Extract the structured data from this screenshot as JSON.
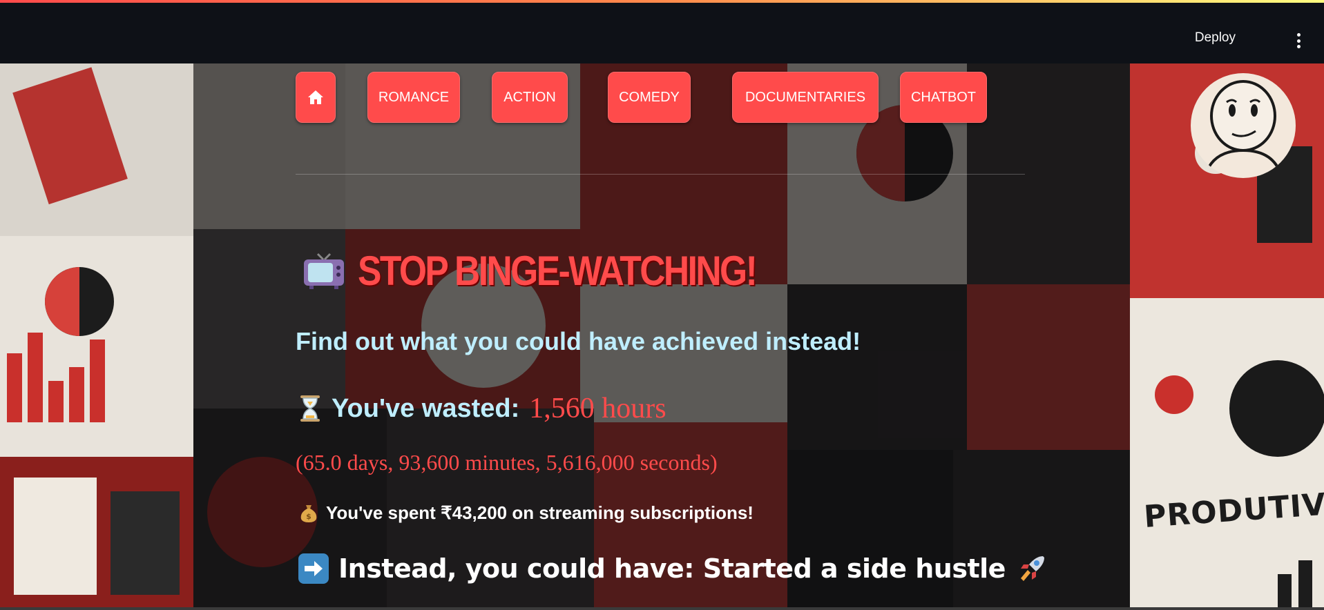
{
  "header": {
    "deploy_label": "Deploy",
    "menu_icon": "more-vertical-icon"
  },
  "nav": {
    "home_icon": "home-icon",
    "items": [
      {
        "label": "ROMANCE"
      },
      {
        "label": "ACTION"
      },
      {
        "label": "COMEDY"
      },
      {
        "label": "DOCUMENTARIES"
      },
      {
        "label": "CHATBOT"
      }
    ]
  },
  "main": {
    "title": "STOP BINGE-WATCHING!",
    "title_icon": "television-icon",
    "subtitle": "Find out what you could have achieved instead!",
    "wasted": {
      "icon": "hourglass-icon",
      "label": "You've wasted:",
      "value": "1,560 hours"
    },
    "breakdown": "(65.0 days, 93,600 minutes, 5,616,000 seconds)",
    "spent": {
      "icon": "money-bag-icon",
      "text": "You've spent ₹43,200 on streaming subscriptions!"
    },
    "instead": {
      "icon": "right-arrow-icon",
      "text": "Instead, you could have: Started a side hustle",
      "trailing_icon": "rocket-icon"
    }
  },
  "background": {
    "poster_text": "PRODUTIVITT"
  },
  "colors": {
    "accent": "#ff4b4b",
    "subtitle": "#bfeeff",
    "header_bg": "#0e1117"
  }
}
